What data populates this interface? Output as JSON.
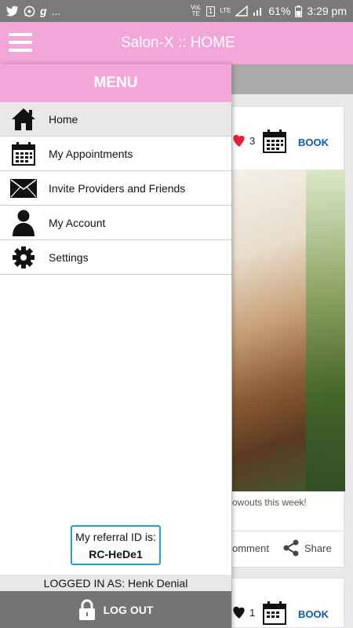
{
  "status_bar": {
    "carrier_glyph": "g",
    "dots": "...",
    "volte": "VoLTE",
    "data_badge": "1",
    "lte": "LTE",
    "battery": "61%",
    "time": "3:29 pm"
  },
  "app_bar": {
    "title": "Salon-X :: HOME"
  },
  "drawer": {
    "header": "MENU",
    "items": [
      {
        "label": "Home",
        "icon": "home-icon",
        "active": true
      },
      {
        "label": "My Appointments",
        "icon": "calendar-icon",
        "active": false
      },
      {
        "label": "Invite Providers and Friends",
        "icon": "envelope-icon",
        "active": false
      },
      {
        "label": "My Account",
        "icon": "user-icon",
        "active": false
      },
      {
        "label": "Settings",
        "icon": "gear-icon",
        "active": false
      }
    ],
    "referral_label": "My referral ID is:",
    "referral_code": "RC-HeDe1",
    "logged_in": "LOGGED IN AS: Henk Denial",
    "logout_label": "LOG OUT"
  },
  "feed": {
    "posts": [
      {
        "likes": "3",
        "book_label": "BOOK",
        "caption": "owouts this week!",
        "comment_label": "omment",
        "share_label": "Share"
      },
      {
        "likes": "1",
        "book_label": "BOOK"
      }
    ]
  },
  "colors": {
    "brand_pink": "#f3a6d8",
    "referral_border": "#26a0cf",
    "book_blue": "#0b5cad",
    "heart_red": "#e0203a"
  }
}
